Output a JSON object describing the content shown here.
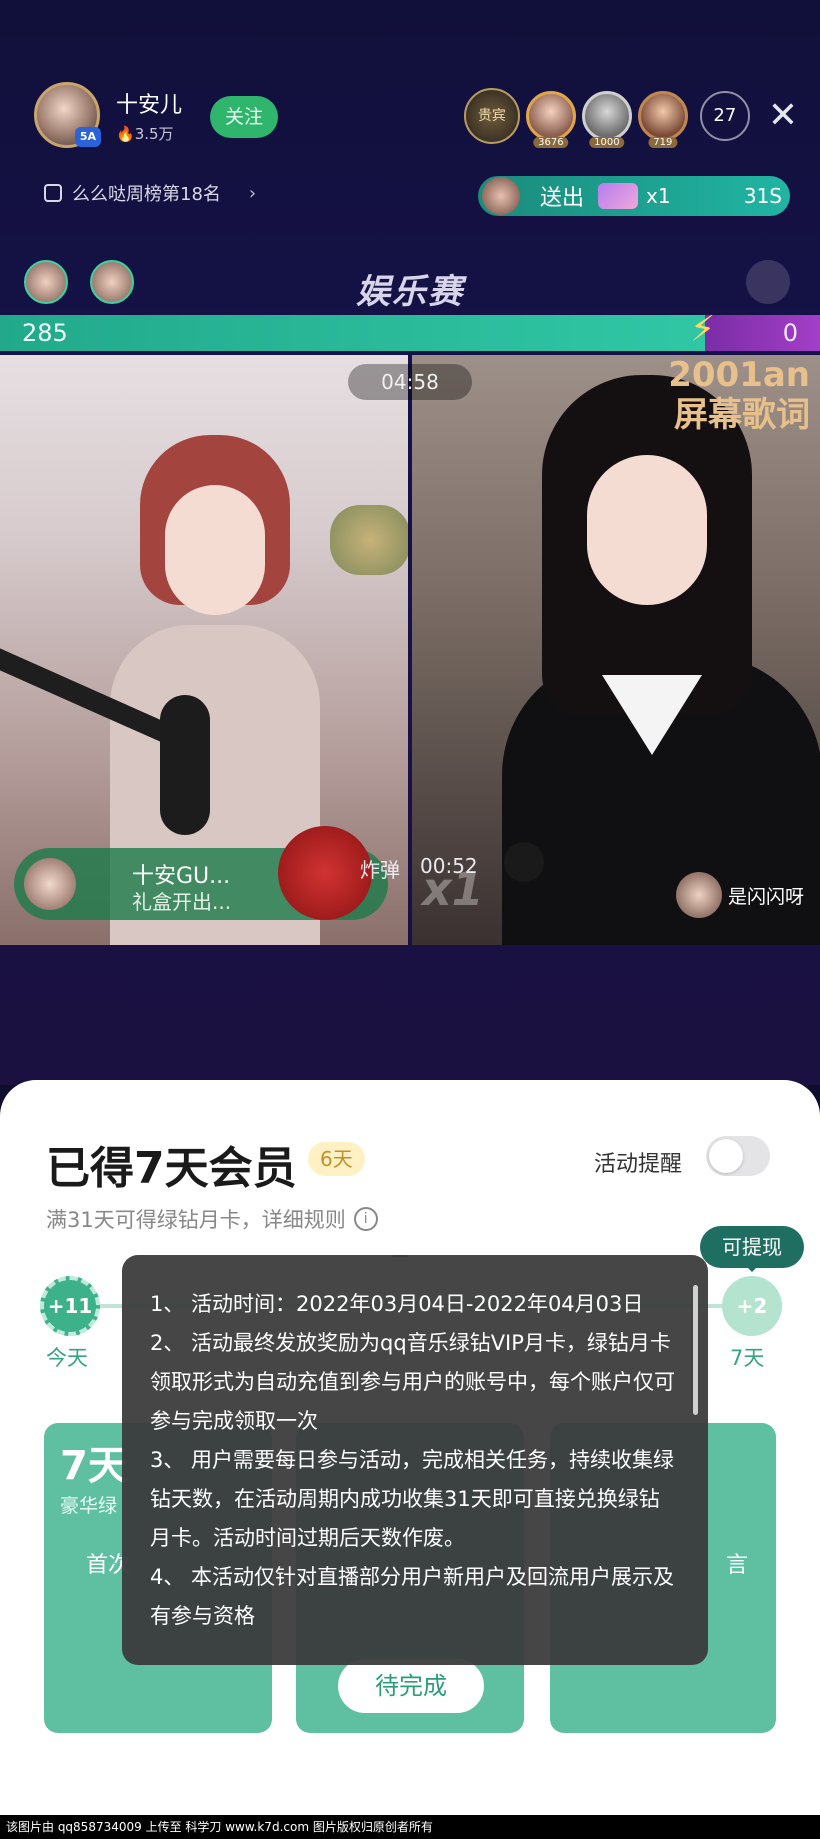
{
  "live": {
    "host_name": "十安儿",
    "host_heat": "3.5万",
    "host_badge": "5A",
    "follow_label": "关注",
    "vip_badge": "贵宾",
    "rank_values": [
      "3676",
      "1000",
      "719"
    ],
    "viewer_count": "27",
    "close_glyph": "✕",
    "weekly_rank": "么么哒周榜第18名",
    "gift_action": "送出",
    "gift_count": "x1",
    "gift_timer": "31S",
    "pk_title": "娱乐赛",
    "score_left": "285",
    "score_right": "0",
    "battle_timer": "04:58",
    "right_overlay_line1": "2001an",
    "right_overlay_line2": "屏幕歌词",
    "bomb_name": "十安GU...",
    "bomb_sub": "礼盒开出...",
    "bomb_label": "炸弹",
    "bomb_time": "00:52",
    "bomb_multiplier": "x1",
    "guest_name": "是闪闪呀"
  },
  "modal": {
    "title": "已得7天会员",
    "days_badge": "6天",
    "remind_label": "活动提醒",
    "remind_on": false,
    "subtitle": "满31天可得绿钻月卡，详细规则",
    "withdraw_tag": "可提现",
    "step_first": "+11",
    "step_first_label": "今天",
    "step_last": "+2",
    "step_last_label": "7天",
    "card1_big": "7天",
    "card1_sub": "豪华绿",
    "card1_task": "首次",
    "card3_task": "言",
    "card2_button": "待完成"
  },
  "tooltip": {
    "items": [
      "1、 活动时间：2022年03月04日-2022年04月03日",
      "2、 活动最终发放奖励为qq音乐绿钻VIP月卡，绿钻月卡领取形式为自动充值到参与用户的账号中，每个账户仅可参与完成领取一次",
      "3、 用户需要每日参与活动，完成相关任务，持续收集绿钻天数，在活动周期内成功收集31天即可直接兑换绿钻月卡。活动时间过期后天数作废。",
      "4、 本活动仅针对直播部分用户新用户及回流用户展示及有参与资格"
    ]
  },
  "footer": {
    "text": "该图片由 qq858734009 上传至 科学刀 www.k7d.com 图片版权归原创者所有"
  },
  "colors": {
    "accent_green": "#3cb18a",
    "card_green": "#5fbfa1",
    "tooltip_bg": "#3a3a3c"
  }
}
